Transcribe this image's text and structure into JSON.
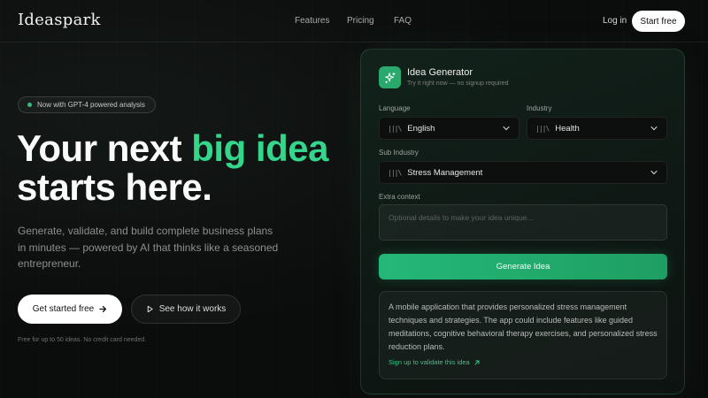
{
  "nav": {
    "logo": "Ideaspark",
    "links": [
      "Features",
      "Pricing",
      "FAQ"
    ],
    "login": "Log in",
    "start": "Start free"
  },
  "hero": {
    "pill": "Now with GPT-4 powered analysis",
    "title_part1": "Your next ",
    "title_accent": "big idea",
    "title_part2": "starts here.",
    "subtitle": "Generate, validate, and build complete business plans in minutes — powered by AI that thinks like a seasoned entrepreneur.",
    "primary_cta": "Get started free",
    "secondary_cta": "See how it works",
    "fine_print": "Free for up to 50 ideas. No credit card needed."
  },
  "card": {
    "title": "Idea Generator",
    "subtitle": "Try it right now — no signup required",
    "language_label": "Language",
    "language_value": "English",
    "industry_label": "Industry",
    "industry_value": "Health",
    "sub_industry_label": "Sub Industry",
    "sub_industry_value": "Stress Management",
    "extra_label": "Extra context",
    "extra_placeholder": "Optional details to make your idea unique...",
    "generate": "Generate Idea",
    "result": "A mobile application that provides personalized stress management techniques and strategies. The app could include features like guided meditations, cognitive behavioral therapy exercises, and personalized stress reduction plans.",
    "result_link": "Sign up to validate this idea",
    "select_icon": "|||\\"
  },
  "icons": {
    "card": "sparkles-icon",
    "select": "library-icon",
    "dropdown": "chevron-down-icon",
    "arrow": "arrow-right-icon",
    "play": "play-icon",
    "external": "arrow-up-right-icon"
  },
  "colors": {
    "accent": "#34d68c",
    "button_green": "#24b878",
    "background": "#0b0c0c"
  }
}
